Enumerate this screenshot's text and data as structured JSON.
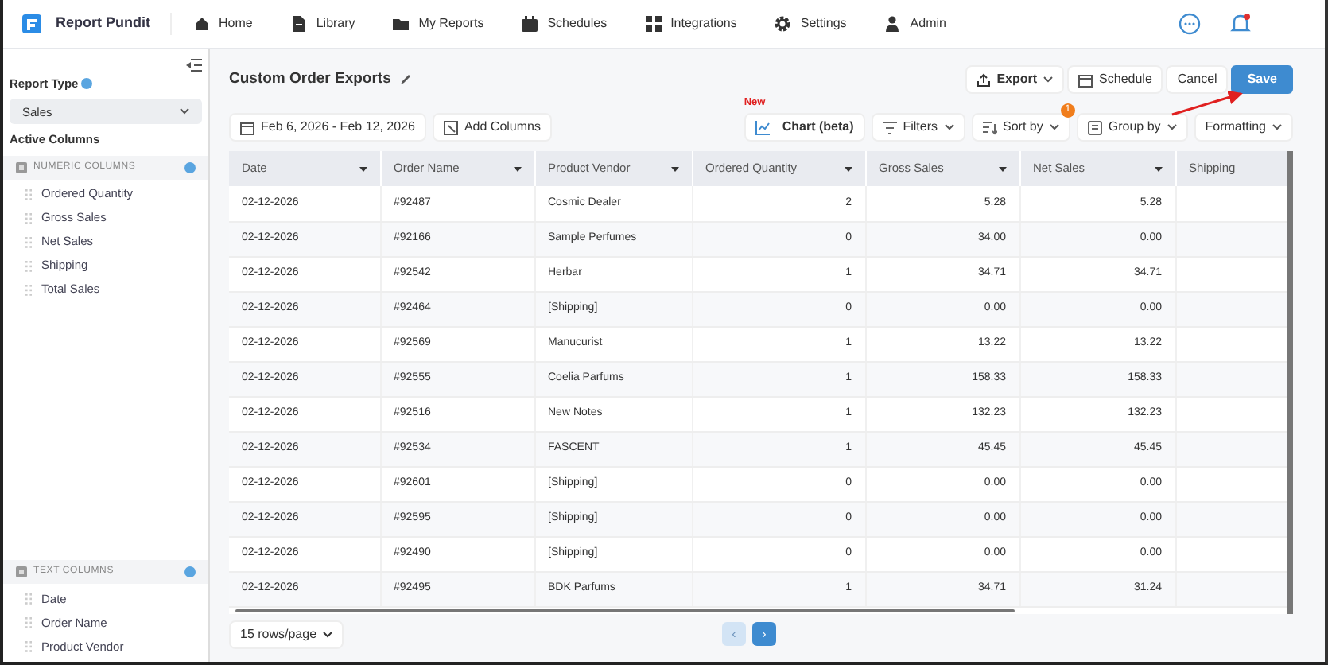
{
  "brand": "Report Pundit",
  "nav": [
    {
      "label": "Home"
    },
    {
      "label": "Library"
    },
    {
      "label": "My Reports"
    },
    {
      "label": "Schedules"
    },
    {
      "label": "Integrations"
    },
    {
      "label": "Settings"
    },
    {
      "label": "Admin"
    }
  ],
  "notifications": {
    "unread": true
  },
  "sidebar": {
    "report_type_label": "Report Type",
    "report_type": "Sales",
    "active_columns": "Active Columns",
    "groups": [
      {
        "title": "NUMERIC COLUMNS",
        "items": [
          "Ordered Quantity",
          "Gross Sales",
          "Net Sales",
          "Shipping",
          "Total Sales"
        ]
      },
      {
        "title": "TEXT COLUMNS",
        "items": [
          "Date",
          "Order Name",
          "Product Vendor"
        ]
      }
    ]
  },
  "title": "Custom Order Exports",
  "actions": [
    {
      "label": "Export",
      "kind": "export"
    },
    {
      "label": "Schedule",
      "kind": "schedule"
    },
    {
      "label": "Cancel",
      "kind": "plain"
    },
    {
      "label": "Save",
      "kind": "primary"
    }
  ],
  "date_range": "Feb 6, 2026 - Feb 12, 2026",
  "add_columns": "Add Columns",
  "chart_button": {
    "label": "Chart (beta)",
    "tag": "New"
  },
  "tools": [
    {
      "label": "Filters"
    },
    {
      "label": "Sort by",
      "badge": "1"
    },
    {
      "label": "Group by"
    },
    {
      "label": "Formatting"
    }
  ],
  "table": {
    "columns": [
      {
        "label": "Date",
        "kind": "text",
        "sortable": true
      },
      {
        "label": "Order Name",
        "kind": "text",
        "sortable": true
      },
      {
        "label": "Product Vendor",
        "kind": "text",
        "sortable": true
      },
      {
        "label": "Ordered Quantity",
        "kind": "number",
        "sortable": true
      },
      {
        "label": "Gross Sales",
        "kind": "number",
        "sortable": true
      },
      {
        "label": "Net Sales",
        "kind": "number",
        "sortable": true
      },
      {
        "label": "Shipping",
        "kind": "number",
        "sortable": false
      }
    ],
    "rows": [
      [
        "02-12-2026",
        "#92487",
        "Cosmic Dealer",
        "2",
        "5.28",
        "5.28"
      ],
      [
        "02-12-2026",
        "#92166",
        "Sample Perfumes",
        "0",
        "34.00",
        "0.00"
      ],
      [
        "02-12-2026",
        "#92542",
        "Herbar",
        "1",
        "34.71",
        "34.71"
      ],
      [
        "02-12-2026",
        "#92464",
        "[Shipping]",
        "0",
        "0.00",
        "0.00"
      ],
      [
        "02-12-2026",
        "#92569",
        "Manucurist",
        "1",
        "13.22",
        "13.22"
      ],
      [
        "02-12-2026",
        "#92555",
        "Coelia Parfums",
        "1",
        "158.33",
        "158.33"
      ],
      [
        "02-12-2026",
        "#92516",
        "New Notes",
        "1",
        "132.23",
        "132.23"
      ],
      [
        "02-12-2026",
        "#92534",
        "FASCENT",
        "1",
        "45.45",
        "45.45"
      ],
      [
        "02-12-2026",
        "#92601",
        "[Shipping]",
        "0",
        "0.00",
        "0.00"
      ],
      [
        "02-12-2026",
        "#92595",
        "[Shipping]",
        "0",
        "0.00",
        "0.00"
      ],
      [
        "02-12-2026",
        "#92490",
        "[Shipping]",
        "0",
        "0.00",
        "0.00"
      ],
      [
        "02-12-2026",
        "#92495",
        "BDK Parfums",
        "1",
        "34.71",
        "31.24"
      ]
    ]
  },
  "page_size": "15 rows/page",
  "pagination": {
    "prev": "‹",
    "next": "›",
    "prev_disabled": true,
    "next_disabled": false
  }
}
